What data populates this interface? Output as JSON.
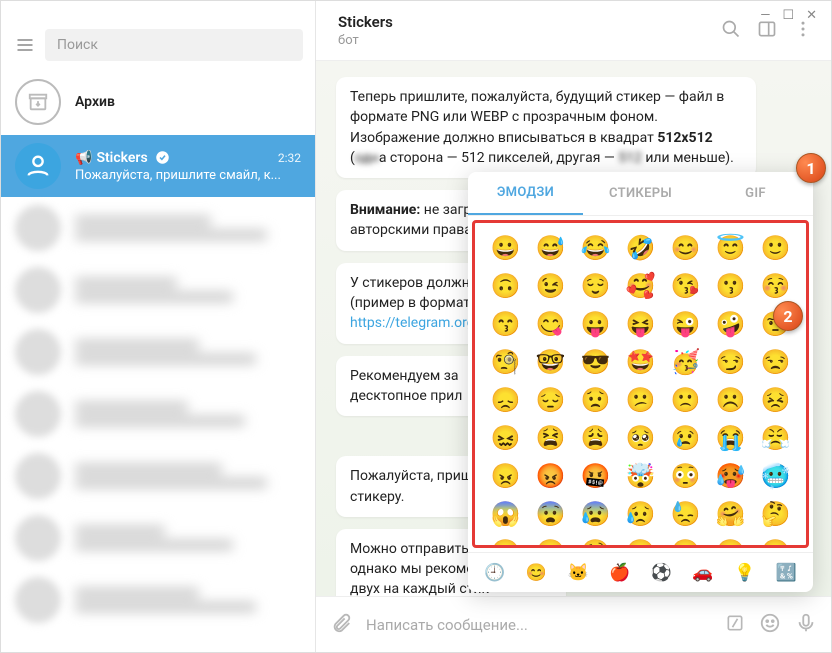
{
  "search": {
    "placeholder": "Поиск"
  },
  "archive": {
    "label": "Архив"
  },
  "active_chat": {
    "name": "Stickers",
    "time": "2:32",
    "preview": "Пожалуйста, пришлите смайл, к..."
  },
  "header": {
    "title": "Stickers",
    "subtitle": "бот"
  },
  "messages": {
    "m1": "Теперь пришлите, пожалуйста, будущий стикер — файл в формате PNG или WEBP с прозрачным фоном. Изображение должно вписываться в квадрат <b>512x512</b> (<span style='filter:blur(3px)'>одн</span>а сторона — 512 пикселей, другая — <span style='filter:blur(3px)'>512</span> или меньше).",
    "m2": "<b>Внимание:</b> не загру<br>авторскими правами",
    "m3": "У стикеров должна б<br>(пример в формате P<br><a>https://telegram.org/i</a>",
    "m4": "Рекомендуем за<br>десктопное прил",
    "m5": "Пожалуйста, пришли<br>стикеру.",
    "m6": "Можно отправить не<br>однако мы рекоменд<br>двух на каждый стик"
  },
  "compose": {
    "placeholder": "Написать сообщение..."
  },
  "emoji": {
    "tabs": {
      "emoji": "ЭМОДЗИ",
      "stickers": "СТИКЕРЫ",
      "gif": "GIF"
    },
    "grid": [
      "😀",
      "😅",
      "😂",
      "🤣",
      "😊",
      "😇",
      "🙂",
      "🙃",
      "😉",
      "😌",
      "🥰",
      "😘",
      "😗",
      "😚",
      "😙",
      "😋",
      "😛",
      "😝",
      "😜",
      "🤪",
      "🤨",
      "🧐",
      "🤓",
      "😎",
      "🤩",
      "🥳",
      "😏",
      "😒",
      "😞",
      "😔",
      "😟",
      "😕",
      "🙁",
      "☹️",
      "😣",
      "😖",
      "😫",
      "😩",
      "🥺",
      "😢",
      "😭",
      "😤",
      "😠",
      "😡",
      "🤬",
      "🤯",
      "😳",
      "🥵",
      "🥶",
      "😱",
      "😨",
      "😰",
      "😥",
      "😓",
      "🤗",
      "🤔",
      "🤭",
      "🤫",
      "🤥",
      "😶",
      "😐",
      "😑",
      "😬"
    ],
    "cats": [
      "🕘",
      "😊",
      "🐱",
      "🍎",
      "⚽",
      "🚗",
      "💡",
      "🔣"
    ]
  },
  "badges": {
    "b1": "1",
    "b2": "2"
  }
}
